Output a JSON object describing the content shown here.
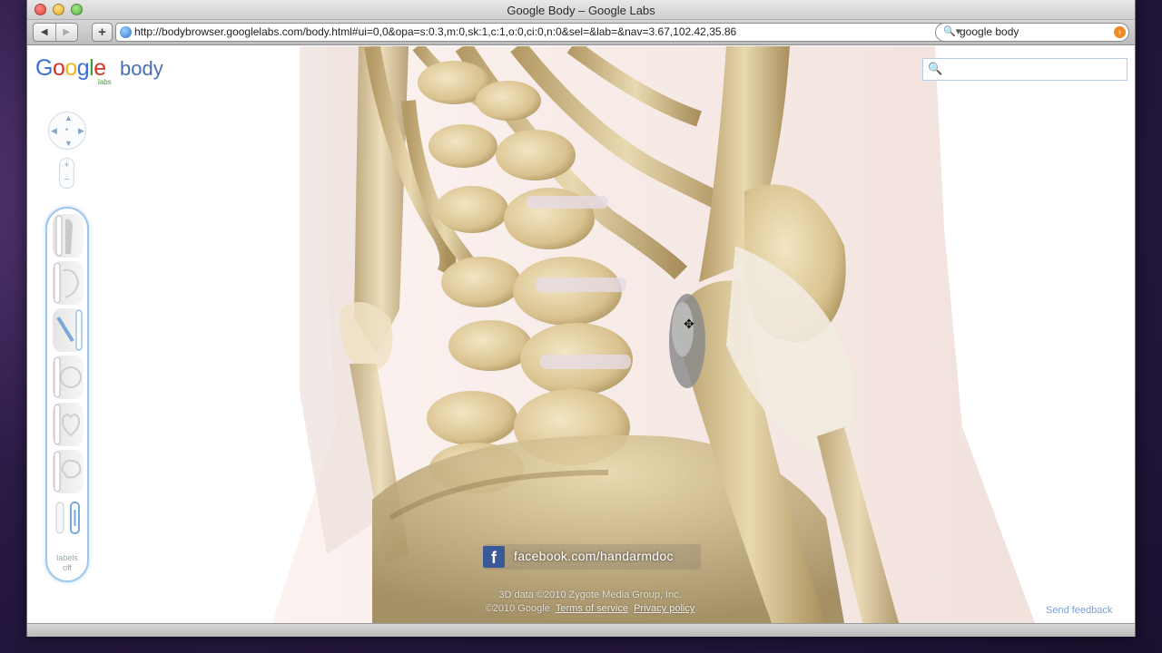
{
  "window": {
    "title": "Google Body – Google Labs"
  },
  "toolbar": {
    "back_icon": "◀",
    "forward_icon": "▶",
    "add_icon": "+",
    "url": "http://bodybrowser.googlelabs.com/body.html#ui=0,0&opa=s:0.3,m:0,sk:1,c:1,o:0,ci:0,n:0&sel=&lab=&nav=3.67,102.42,35.86",
    "reload_icon": "↻",
    "search_value": "google body",
    "search_icon": "🔍▾"
  },
  "app": {
    "logo": {
      "G": "G",
      "o1": "o",
      "o2": "o",
      "g": "g",
      "l": "l",
      "e": "e",
      "body": "body",
      "labs": "labs"
    },
    "nav": {
      "up": "▲",
      "down": "▼",
      "left": "◀",
      "right": "▶",
      "center": "•",
      "zoom_in": "+",
      "zoom_out": "−"
    },
    "labels_toggle": "labels\noff",
    "search_icon": "🔍",
    "facebook": {
      "icon": "f",
      "text": "facebook.com/handarmdoc"
    },
    "copyright_line1": "3D data ©2010 Zygote Media Group, Inc.",
    "copyright_google": "©2010 Google",
    "terms": "Terms of service",
    "privacy": "Privacy policy",
    "feedback": "Send feedback",
    "cursor": "✥"
  },
  "colors": {
    "google_blue": "#3a6fd8",
    "google_red": "#d8322a",
    "google_yellow": "#e8b71a",
    "google_green": "#3d9c3d",
    "bone": "#e6d3a6",
    "panel_border": "#9fc7ec",
    "facebook": "#3b5998"
  }
}
